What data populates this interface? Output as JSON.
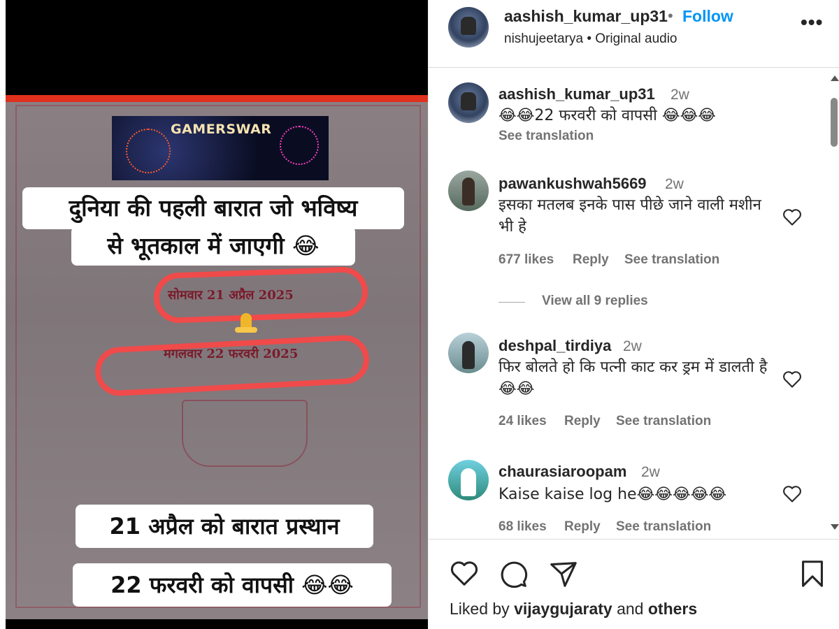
{
  "video": {
    "watermark": "GAMERSWAR",
    "caption_top_line1": "दुनिया की पहली बारात जो भविष्य",
    "caption_top_line2": "से भूतकाल में जाएगी 😂",
    "invite_line1": "सोमवार 21 अप्रैल 2025",
    "invite_line2": "मंगलवार 22 फरवरी 2025",
    "caption_bottom1": "21 अप्रैल को बारात प्रस्थान",
    "caption_bottom2": "22 फरवरी को वापसी 😂😂"
  },
  "header": {
    "username": "aashish_kumar_up31",
    "separator": "•",
    "follow_label": "Follow",
    "audio_user": "nishujeetarya",
    "audio_separator": "•",
    "audio_label": "Original audio",
    "more_label": "•••"
  },
  "comments": [
    {
      "username": "aashish_kumar_up31",
      "time": "2w",
      "text": "😂😂22 फरवरी को वापसी 😂😂😂",
      "see_translation": "See translation"
    },
    {
      "username": "pawankushwah5669",
      "time": "2w",
      "text": "इसका मतलब इनके पास पीछे जाने वाली मशीन भी हे",
      "likes": "677 likes",
      "reply": "Reply",
      "see_translation": "See translation",
      "view_replies": "View all 9 replies"
    },
    {
      "username": "deshpal_tirdiya",
      "time": "2w",
      "text": "फिर बोलते हो कि पत्नी काट कर ड्रम में डालती है😂😂",
      "likes": "24 likes",
      "reply": "Reply",
      "see_translation": "See translation"
    },
    {
      "username": "chaurasiaroopam",
      "time": "2w",
      "text": "Kaise kaise log he😂😂😂😂😂",
      "likes": "68 likes",
      "reply": "Reply",
      "see_translation": "See translation"
    }
  ],
  "footer": {
    "liked_prefix": "Liked by ",
    "liked_user": "vijaygujaraty",
    "liked_mid": " and ",
    "liked_others": "others"
  },
  "icons": [
    "heart-icon",
    "comment-icon",
    "share-icon",
    "bookmark-icon",
    "more-options-icon"
  ],
  "colors": {
    "follow": "#0095f6",
    "annotation_red": "#f04a4a",
    "text": "#262626",
    "muted": "#737373"
  }
}
